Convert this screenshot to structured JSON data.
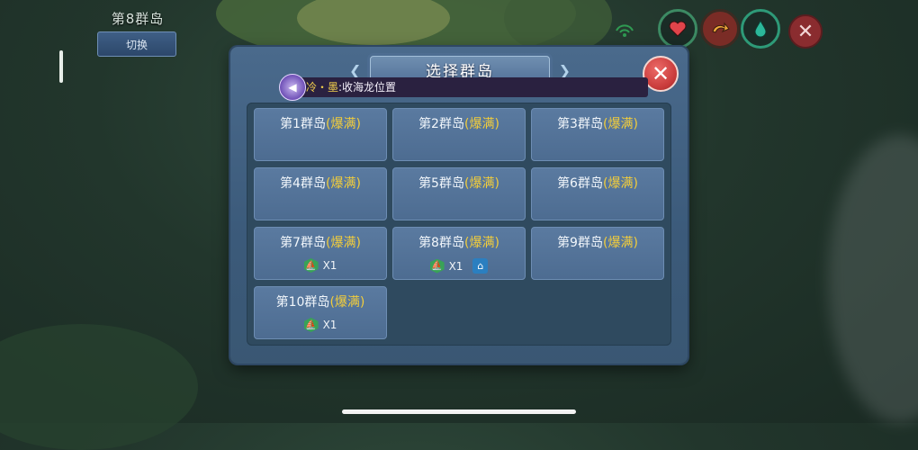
{
  "hud": {
    "current_island": "第8群岛",
    "switch_label": "切换",
    "close_glyph": "✕",
    "icons": [
      "heart-icon",
      "swap-arrow-icon",
      "water-drop-icon"
    ]
  },
  "dialog": {
    "title": "选择群岛",
    "close_glyph": "✕",
    "announcement": {
      "sender": "冷・墨",
      "message": ":收海龙位置"
    },
    "islands": [
      {
        "name": "第1群岛",
        "status": "(爆满)",
        "boats": "",
        "home": false
      },
      {
        "name": "第2群岛",
        "status": "(爆满)",
        "boats": "",
        "home": false
      },
      {
        "name": "第3群岛",
        "status": "(爆满)",
        "boats": "",
        "home": false
      },
      {
        "name": "第4群岛",
        "status": "(爆满)",
        "boats": "",
        "home": false
      },
      {
        "name": "第5群岛",
        "status": "(爆满)",
        "boats": "",
        "home": false
      },
      {
        "name": "第6群岛",
        "status": "(爆满)",
        "boats": "",
        "home": false
      },
      {
        "name": "第7群岛",
        "status": "(爆满)",
        "boats": "X1",
        "home": false
      },
      {
        "name": "第8群岛",
        "status": "(爆满)",
        "boats": "X1",
        "home": true
      },
      {
        "name": "第9群岛",
        "status": "(爆满)",
        "boats": "",
        "home": false
      },
      {
        "name": "第10群岛",
        "status": "(爆满)",
        "boats": "X1",
        "home": false
      }
    ]
  },
  "colors": {
    "status_full": "#f2cd3c",
    "card": "#5a7aa0",
    "close_red": "#c93b3b"
  }
}
